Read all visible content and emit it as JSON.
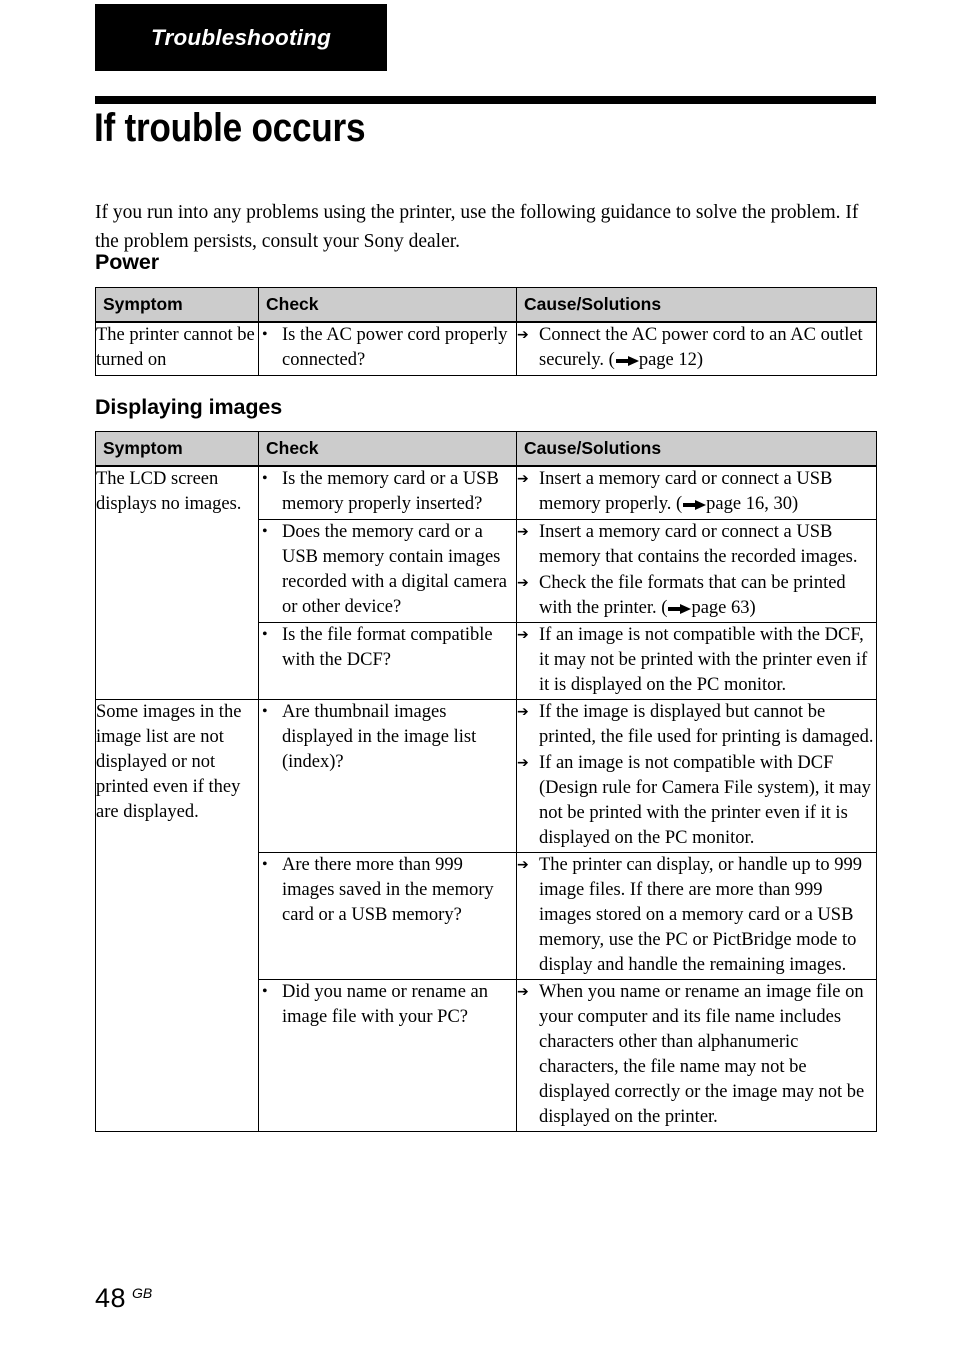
{
  "running_head": {
    "label": "Troubleshooting"
  },
  "chapter": {
    "title": "If trouble occurs"
  },
  "intro": "If you run into any problems using the printer, use the following guidance to solve the problem. If the problem persists, consult your Sony dealer.",
  "columns": {
    "symptom": "Symptom",
    "check": "Check",
    "cause": "Cause/Solutions"
  },
  "sections": [
    {
      "heading": "Power",
      "rows": [
        {
          "symptom": "The printer cannot be turned on",
          "subrows": [
            {
              "checks": [
                "Is the AC power cord properly connected?"
              ],
              "causes": [
                {
                  "text_before": "Connect the AC power cord to an AC outlet securely. (",
                  "page_ref": "page 12",
                  "text_after": ")"
                }
              ]
            }
          ]
        }
      ]
    },
    {
      "heading": "Displaying images",
      "rows": [
        {
          "symptom": "The LCD screen displays no images.",
          "subrows": [
            {
              "checks": [
                "Is the memory card or a USB memory properly inserted?"
              ],
              "causes": [
                {
                  "text_before": "Insert a memory card or connect a USB memory properly. (",
                  "page_ref": "page 16, 30",
                  "text_after": ")"
                }
              ]
            },
            {
              "checks": [
                "Does the memory card or a USB memory contain images recorded with a digital camera or other device?"
              ],
              "causes": [
                {
                  "text_before": "Insert a memory card or connect a USB memory that contains the recorded images.",
                  "page_ref": "",
                  "text_after": ""
                },
                {
                  "text_before": "Check the file formats that can be printed with the printer. (",
                  "page_ref": "page 63",
                  "text_after": ")"
                }
              ]
            },
            {
              "checks": [
                "Is the file format compatible with the DCF?"
              ],
              "causes": [
                {
                  "text_before": "If an image is not compatible with the DCF, it may not be printed with the printer even if it is displayed on the PC monitor.",
                  "page_ref": "",
                  "text_after": ""
                }
              ]
            }
          ]
        },
        {
          "symptom": "Some images in the image list are not displayed or not printed even if they are displayed.",
          "subrows": [
            {
              "checks": [
                "Are thumbnail images displayed in the image list (index)?"
              ],
              "causes": [
                {
                  "text_before": "If the image is displayed but cannot be printed, the file used for printing is damaged.",
                  "page_ref": "",
                  "text_after": ""
                },
                {
                  "text_before": "If an image is not compatible with DCF (Design rule for Camera File system), it may not be printed with the printer even if it is displayed on the PC monitor.",
                  "page_ref": "",
                  "text_after": ""
                }
              ]
            },
            {
              "checks": [
                "Are there more than 999 images saved in the memory card or a USB memory?"
              ],
              "causes": [
                {
                  "text_before": "The printer can display, or handle up to 999 image files. If there are more than 999 images stored on a memory card or a USB memory, use the PC or PictBridge mode to display and handle the remaining images.",
                  "page_ref": "",
                  "text_after": ""
                }
              ]
            },
            {
              "checks": [
                "Did you name or rename an image file with your PC?"
              ],
              "causes": [
                {
                  "text_before": "When you name or rename an image file on your computer and its file name includes characters other than alphanumeric characters, the file name may not be displayed correctly or the image may not be displayed on the printer.",
                  "page_ref": "",
                  "text_after": ""
                }
              ]
            }
          ]
        }
      ]
    }
  ],
  "footer": {
    "page_number": "48",
    "region": "GB"
  },
  "colors": {
    "banner_bg": "#000000",
    "banner_text": "#ffffff",
    "table_header_bg": "#cccccc",
    "rule": "#000000"
  }
}
